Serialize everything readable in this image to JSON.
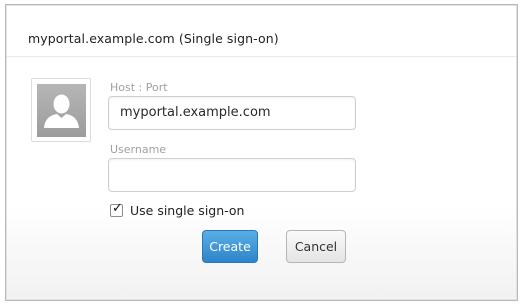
{
  "dialog": {
    "title": "myportal.example.com (Single sign-on)"
  },
  "avatar": {
    "icon": "user-silhouette-icon"
  },
  "form": {
    "host_port_label": "Host : Port",
    "host_port_value": "myportal.example.com",
    "username_label": "Username",
    "username_value": "",
    "use_sso_label": "Use single sign-on",
    "use_sso_checked": true
  },
  "buttons": {
    "create_label": "Create",
    "cancel_label": "Cancel"
  },
  "colors": {
    "primary_button": "#3d93d6",
    "border": "#cfcfcf",
    "label": "#a0a0a0"
  }
}
